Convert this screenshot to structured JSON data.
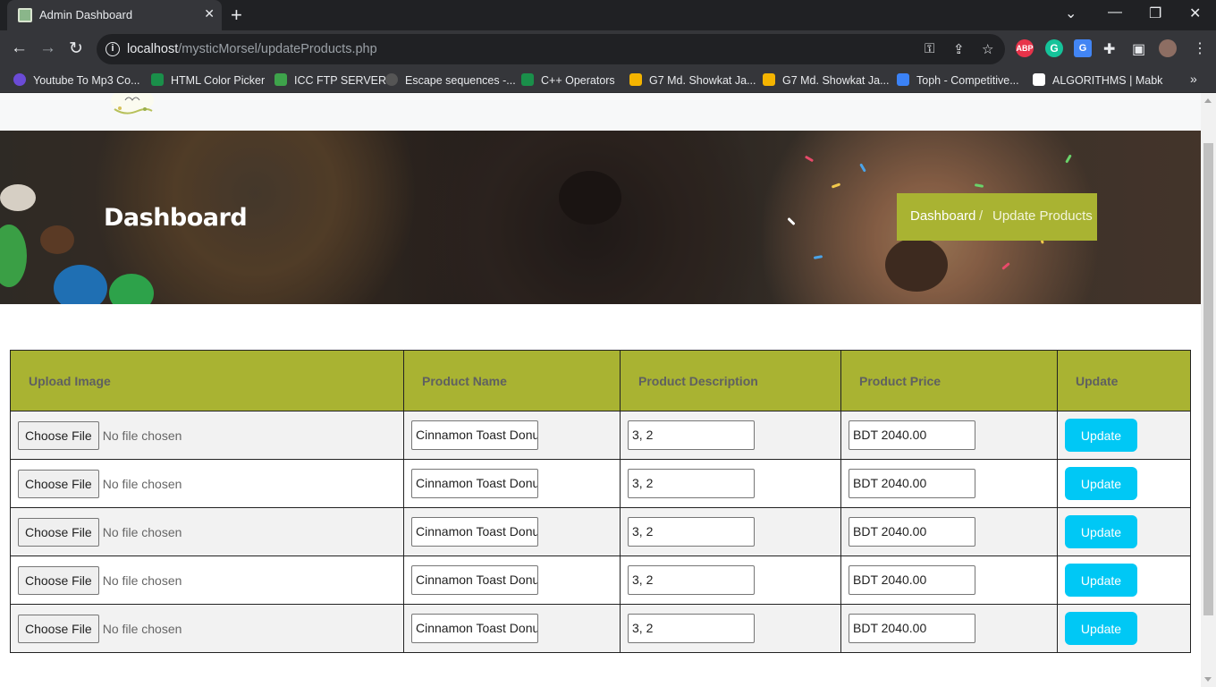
{
  "browser": {
    "tab_title": "Admin Dashboard",
    "url_host": "localhost",
    "url_path": "/mysticMorsel/updateProducts.php",
    "bookmarks": [
      {
        "label": "Youtube To Mp3 Co...",
        "color": "#6b4bd6"
      },
      {
        "label": "HTML Color Picker",
        "color": "#1a8f4a"
      },
      {
        "label": "ICC FTP SERVER",
        "color": "#3ea34b"
      },
      {
        "label": "Escape sequences -...",
        "color": "#555555"
      },
      {
        "label": "C++ Operators",
        "color": "#1a8f4a"
      },
      {
        "label": "G7 Md. Showkat Ja...",
        "color": "#f4b400"
      },
      {
        "label": "G7 Md. Showkat Ja...",
        "color": "#f4b400"
      },
      {
        "label": "Toph - Competitive...",
        "color": "#3b82f6"
      },
      {
        "label": "ALGORITHMS | Mabk",
        "color": "#ffffff"
      }
    ],
    "extensions": [
      {
        "name": "adblock",
        "text": "ABP",
        "color": "#e8334a"
      },
      {
        "name": "grammarly",
        "text": "G",
        "color": "#15c39a"
      },
      {
        "name": "translate",
        "text": "G",
        "color": "#4285f4"
      }
    ]
  },
  "hero": {
    "title": "Dashboard",
    "breadcrumb_home": "Dashboard",
    "breadcrumb_sep": "/",
    "breadcrumb_current": "Update Products"
  },
  "table": {
    "headers": [
      "Upload Image",
      "Product Name",
      "Product Description",
      "Product Price",
      "Update"
    ],
    "rows": [
      {
        "file_button": "Choose File",
        "file_status": "No file chosen",
        "name": "Cinnamon Toast Donut,",
        "description": "3, 2",
        "price": "BDT 2040.00",
        "update": "Update"
      },
      {
        "file_button": "Choose File",
        "file_status": "No file chosen",
        "name": "Cinnamon Toast Donut,",
        "description": "3, 2",
        "price": "BDT 2040.00",
        "update": "Update"
      },
      {
        "file_button": "Choose File",
        "file_status": "No file chosen",
        "name": "Cinnamon Toast Donut,",
        "description": "3, 2",
        "price": "BDT 2040.00",
        "update": "Update"
      },
      {
        "file_button": "Choose File",
        "file_status": "No file chosen",
        "name": "Cinnamon Toast Donut,",
        "description": "3, 2",
        "price": "BDT 2040.00",
        "update": "Update"
      },
      {
        "file_button": "Choose File",
        "file_status": "No file chosen",
        "name": "Cinnamon Toast Donut,",
        "description": "3, 2",
        "price": "BDT 2040.00",
        "update": "Update"
      }
    ]
  },
  "colors": {
    "accent": "#a9b332",
    "update_button": "#00c8f5"
  }
}
